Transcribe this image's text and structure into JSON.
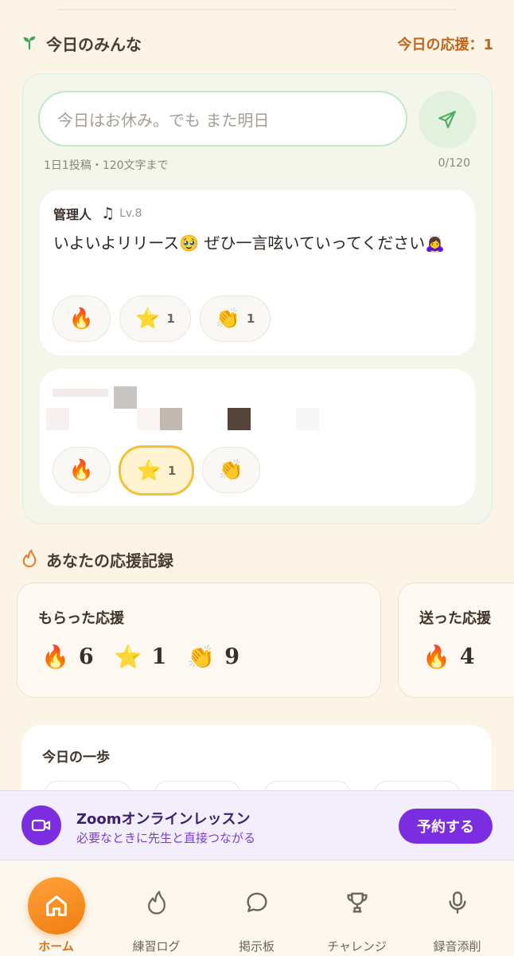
{
  "everyone": {
    "title": "今日のみんな",
    "support_today": "今日の応援：1",
    "input_placeholder": "今日はお休み。でも また明日",
    "hint_left": "1日1投稿・120文字まで",
    "hint_right": "0/120"
  },
  "posts": [
    {
      "author": "管理人",
      "badge_icon": "music-note-icon",
      "level": "Lv.8",
      "text": "いよいよリリース🥹 ぜひ一言呟いていってください🙇‍♀️",
      "reactions": [
        {
          "emoji": "🔥",
          "count": ""
        },
        {
          "emoji": "⭐",
          "count": "1"
        },
        {
          "emoji": "👏",
          "count": "1"
        }
      ]
    },
    {
      "author": "",
      "text": "",
      "reactions": [
        {
          "emoji": "🔥",
          "count": ""
        },
        {
          "emoji": "⭐",
          "count": "1",
          "active": true
        },
        {
          "emoji": "👏",
          "count": ""
        }
      ]
    }
  ],
  "records": {
    "title": "あなたの応援記録",
    "received": {
      "title": "もらった応援",
      "stats": [
        {
          "emoji": "🔥",
          "value": "6"
        },
        {
          "emoji": "⭐",
          "value": "1"
        },
        {
          "emoji": "👏",
          "value": "9"
        }
      ]
    },
    "sent": {
      "title": "送った応援",
      "stats": [
        {
          "emoji": "🔥",
          "value": "4"
        }
      ]
    }
  },
  "step": {
    "title": "今日の一歩"
  },
  "zoom": {
    "title": "Zoomオンラインレッスン",
    "subtitle": "必要なときに先生と直接つながる",
    "button": "予約する"
  },
  "tabs": [
    {
      "label": "ホーム",
      "icon": "home-icon",
      "active": true
    },
    {
      "label": "練習ログ",
      "icon": "flame-icon"
    },
    {
      "label": "掲示板",
      "icon": "chat-bubble-icon"
    },
    {
      "label": "チャレンジ",
      "icon": "trophy-icon"
    },
    {
      "label": "録音添削",
      "icon": "microphone-icon"
    }
  ],
  "colors": {
    "background": "#fbf4e7",
    "accent_orange": "#f07d10",
    "accent_green": "#3ea84f",
    "accent_purple": "#7b2ee0"
  }
}
